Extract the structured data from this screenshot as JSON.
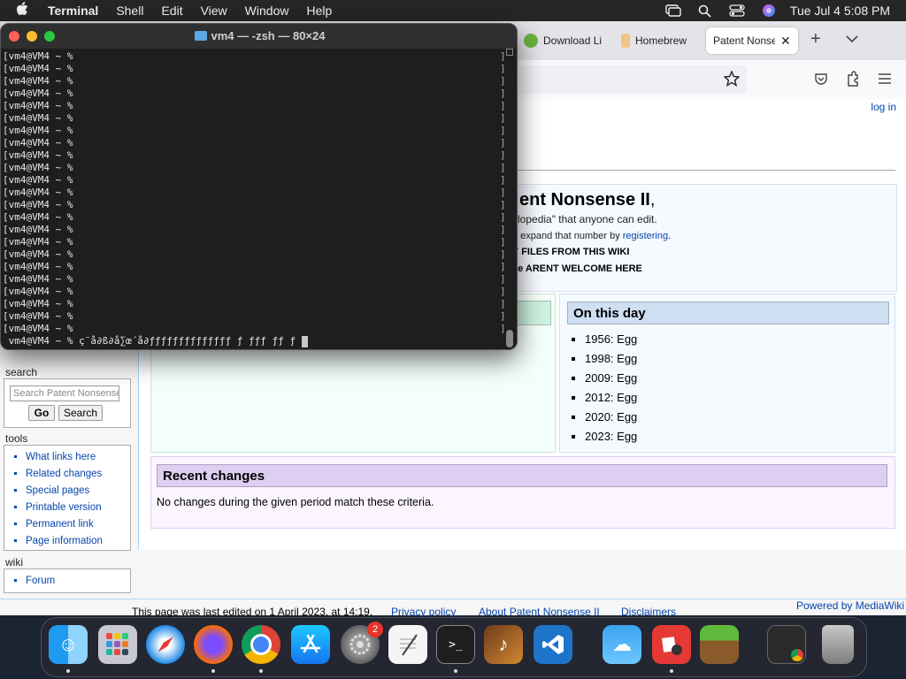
{
  "menubar": {
    "app": "Terminal",
    "items": [
      "Shell",
      "Edit",
      "View",
      "Window",
      "Help"
    ],
    "clock": "Tue Jul 4  5:08 PM"
  },
  "browser": {
    "tabs": [
      {
        "label": "Download Li"
      },
      {
        "label": "Homebrew"
      },
      {
        "label": "Patent Nonse"
      }
    ],
    "login": "log in"
  },
  "wiki": {
    "welcome": {
      "title": "ent Nonsense II",
      "title_suffix": ",",
      "line2": "clopedia\" that anyone can edit.",
      "line3_prefix": "o expand that number by ",
      "line3_link": "registering",
      "line3_suffix": ".",
      "line4": "Y FILES FROM THIS WIKI",
      "line5": "ke ARENT WELCOME HERE"
    },
    "on_this_day": {
      "heading": "On this day",
      "items": [
        "1956: Egg",
        "1998: Egg",
        "2009: Egg",
        "2012: Egg",
        "2020: Egg",
        "2023: Egg"
      ]
    },
    "recent": {
      "heading": "Recent changes",
      "text": "No changes during the given period match these criteria."
    },
    "sidebar": {
      "search_label": "search",
      "search_placeholder": "Search Patent Nonsense II",
      "go": "Go",
      "search": "Search",
      "tools_label": "tools",
      "tools": [
        "What links here",
        "Related changes",
        "Special pages",
        "Printable version",
        "Permanent link",
        "Page information"
      ],
      "wiki_label": "wiki",
      "wiki_items": [
        "Forum"
      ]
    },
    "footer": {
      "last_edited": "This page was last edited on 1 April 2023, at 14:19.",
      "privacy": "Privacy policy",
      "about": "About Patent Nonsense II",
      "disclaimers": "Disclaimers",
      "powered": "Powered by MediaWiki"
    }
  },
  "terminal": {
    "title": "vm4 — -zsh — 80×24",
    "prompt_lines": [
      "[vm4@VM4 ~ %",
      "[vm4@VM4 ~ %",
      "[vm4@VM4 ~ %",
      "[vm4@VM4 ~ %",
      "[vm4@VM4 ~ %",
      "[vm4@VM4 ~ %",
      "[vm4@VM4 ~ %",
      "[vm4@VM4 ~ %",
      "[vm4@VM4 ~ %",
      "[vm4@VM4 ~ %",
      "[vm4@VM4 ~ %",
      "[vm4@VM4 ~ %",
      "[vm4@VM4 ~ %",
      "[vm4@VM4 ~ %",
      "[vm4@VM4 ~ %",
      "[vm4@VM4 ~ %",
      "[vm4@VM4 ~ %",
      "[vm4@VM4 ~ %",
      "[vm4@VM4 ~ %",
      "[vm4@VM4 ~ %",
      "[vm4@VM4 ~ %",
      "[vm4@VM4 ~ %",
      "[vm4@VM4 ~ %"
    ],
    "last_line": "vm4@VM4 ~ % ç¨å∂ß∂å∑œ´å∂ƒƒƒƒƒƒƒƒƒƒƒƒƒƒ ƒ ƒƒƒ ƒƒ ƒ "
  },
  "dock": {
    "settings_badge": "2"
  }
}
